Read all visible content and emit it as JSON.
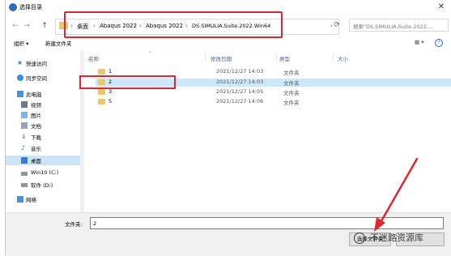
{
  "window": {
    "title": "选择目录",
    "close_glyph": "✕"
  },
  "nav": {
    "back_glyph": "←",
    "forward_glyph": "→",
    "up_glyph": "↑",
    "breadcrumb": [
      "桌面",
      "Abaqus 2022",
      "Abaqus 2022",
      "DS.SIMULIA.Suite.2022.Win64"
    ],
    "sep_glyph": "›",
    "dropdown_glyph": "›",
    "refresh_glyph": "⟳",
    "search_placeholder": "搜索\"DS.SIMULIA.Suite.2022...."
  },
  "toolbar": {
    "organize": "组织 ▾",
    "new_folder": "新建文件夹",
    "view_glyph": "▦ ▾",
    "help_glyph": "?"
  },
  "sidebar": {
    "items": [
      {
        "label": "快速访问",
        "icon": "star-icon"
      },
      {
        "label": "同步空间",
        "icon": "sync-icon"
      },
      {
        "label": "此电脑",
        "icon": "computer-icon"
      },
      {
        "label": "视频",
        "icon": "video-icon"
      },
      {
        "label": "图片",
        "icon": "picture-icon"
      },
      {
        "label": "文档",
        "icon": "document-icon"
      },
      {
        "label": "下载",
        "icon": "download-icon"
      },
      {
        "label": "音乐",
        "icon": "music-icon"
      },
      {
        "label": "桌面",
        "icon": "desktop-icon"
      },
      {
        "label": "Win10 (C:)",
        "icon": "drive-icon"
      },
      {
        "label": "软件 (D:)",
        "icon": "drive-icon"
      },
      {
        "label": "网络",
        "icon": "network-icon"
      }
    ]
  },
  "list": {
    "columns": [
      "名称",
      "修改日期",
      "类型",
      "大小"
    ],
    "rows": [
      {
        "name": "1",
        "date": "2021/12/27 14:03",
        "type": "文件夹"
      },
      {
        "name": "2",
        "date": "2021/12/27 14:03",
        "type": "文件夹"
      },
      {
        "name": "3",
        "date": "2021/12/27 14:05",
        "type": "文件夹"
      },
      {
        "name": "5",
        "date": "2021/12/27 14:06",
        "type": "文件夹"
      }
    ]
  },
  "bottom": {
    "filename_label": "文件夹:",
    "filename_value": "2",
    "ok_label": "选择文件夹"
  },
  "watermark": "不迷路资源库",
  "colors": {
    "annotation_red": "#e4252d",
    "selection": "#cce8ff",
    "folder": "#f0c75e"
  }
}
